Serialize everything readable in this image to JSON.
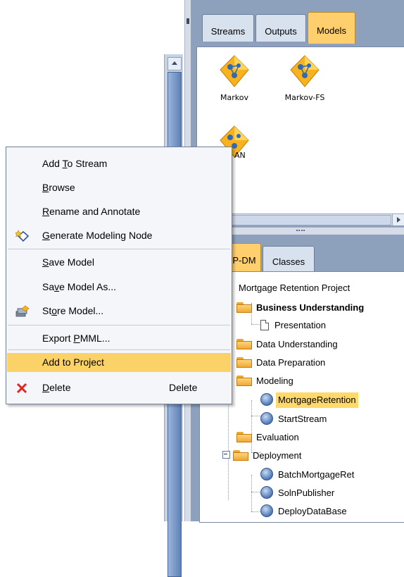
{
  "top_panel": {
    "tabs": [
      {
        "label": "Streams",
        "active": false
      },
      {
        "label": "Outputs",
        "active": false
      },
      {
        "label": "Models",
        "active": true
      }
    ],
    "models": [
      {
        "label": "Markov",
        "icon": "model-nugget-icon"
      },
      {
        "label": "Markov-FS",
        "icon": "model-nugget-icon"
      },
      {
        "label": "AN",
        "icon": "model-nugget-icon"
      }
    ]
  },
  "bottom_panel": {
    "tabs": [
      {
        "label": "P-DM",
        "active": true
      },
      {
        "label": "Classes",
        "active": false
      }
    ],
    "tree": {
      "root": "Mortgage Retention Project",
      "items": [
        {
          "label": "Business Understanding",
          "icon": "folder-icon",
          "bold": true
        },
        {
          "label": "Presentation",
          "icon": "document-icon"
        },
        {
          "label": "Data Understanding",
          "icon": "folder-icon"
        },
        {
          "label": "Data Preparation",
          "icon": "folder-icon"
        },
        {
          "label": "Modeling",
          "icon": "folder-icon"
        },
        {
          "label": "MortgageRetention",
          "icon": "stream-icon",
          "selected": true
        },
        {
          "label": "StartStream",
          "icon": "stream-icon"
        },
        {
          "label": "Evaluation",
          "icon": "folder-icon"
        },
        {
          "label": "Deployment",
          "icon": "folder-icon"
        },
        {
          "label": "BatchMortgageRet",
          "icon": "stream-icon"
        },
        {
          "label": "SolnPublisher",
          "icon": "stream-icon"
        },
        {
          "label": "DeployDataBase",
          "icon": "stream-icon"
        }
      ]
    }
  },
  "context_menu": {
    "items": [
      {
        "pre": "Add ",
        "ul": "T",
        "post": "o Stream"
      },
      {
        "pre": "",
        "ul": "B",
        "post": "rowse"
      },
      {
        "pre": "",
        "ul": "R",
        "post": "ename and Annotate"
      },
      {
        "pre": "",
        "ul": "G",
        "post": "enerate Modeling Node",
        "icon": "generate-node-icon"
      },
      {
        "pre": "",
        "ul": "S",
        "post": "ave Model"
      },
      {
        "pre": "Sa",
        "ul": "v",
        "post": "e Model As..."
      },
      {
        "pre": "St",
        "ul": "o",
        "post": "re Model...",
        "icon": "store-model-icon"
      },
      {
        "pre": "Export ",
        "ul": "P",
        "post": "MML..."
      },
      {
        "pre": "Add to Project",
        "ul": "",
        "post": "",
        "highlighted": true
      },
      {
        "pre": "",
        "ul": "D",
        "post": "elete",
        "shortcut": "Delete",
        "icon": "delete-x-icon"
      }
    ]
  },
  "colors": {
    "highlight": "#fbd267",
    "active_tab": "#ffcf6e",
    "panel_bg": "#8da0bc"
  }
}
